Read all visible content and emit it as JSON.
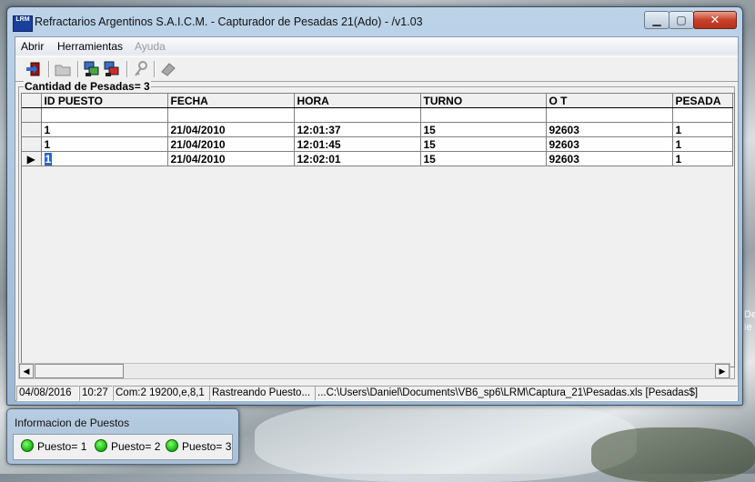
{
  "window": {
    "title": "Refractarios Argentinos S.A.I.C.M. - Capturador de Pesadas 21(Ado) - /v1.03",
    "icon_label": "LRM",
    "controls": {
      "minimize": "▁",
      "maximize": "▢",
      "close": "✕"
    }
  },
  "menu": {
    "items": [
      {
        "label": "Abrir",
        "enabled": true
      },
      {
        "label": "Herramientas",
        "enabled": true
      },
      {
        "label": "Ayuda",
        "enabled": false
      }
    ]
  },
  "toolbar": {
    "icons": [
      "exit-icon",
      "open-folder-icon",
      "connect-icon",
      "disconnect-icon",
      "key-icon",
      "eraser-icon"
    ]
  },
  "frame": {
    "label": "Cantidad de Pesadas= 3"
  },
  "table": {
    "columns": [
      "ID PUESTO",
      "FECHA",
      "HORA",
      "TURNO",
      "O T",
      "PESADA"
    ],
    "rows": [
      [
        "1",
        "21/04/2010",
        "12:01:37",
        "15",
        "92603",
        "1"
      ],
      [
        "1",
        "21/04/2010",
        "12:01:45",
        "15",
        "92603",
        "1"
      ],
      [
        "1",
        "21/04/2010",
        "12:02:01",
        "15",
        "92603",
        "1"
      ]
    ],
    "current_row_marker": "▶"
  },
  "statusbar": {
    "date": "04/08/2016",
    "time": "10:27",
    "com": "Com:2 19200,e,8,1",
    "status": "Rastreando Puesto...",
    "path": "...C:\\Users\\Daniel\\Documents\\VB6_sp6\\LRM\\Captura_21\\Pesadas.xls [Pesadas$]"
  },
  "info_window": {
    "title": "Informacion de Puestos",
    "puestos": [
      "Puesto= 1",
      "Puesto= 2",
      "Puesto= 3"
    ],
    "led_color": "#19b10d"
  },
  "desktop": {
    "partial_text": [
      "De",
      "ie"
    ]
  }
}
